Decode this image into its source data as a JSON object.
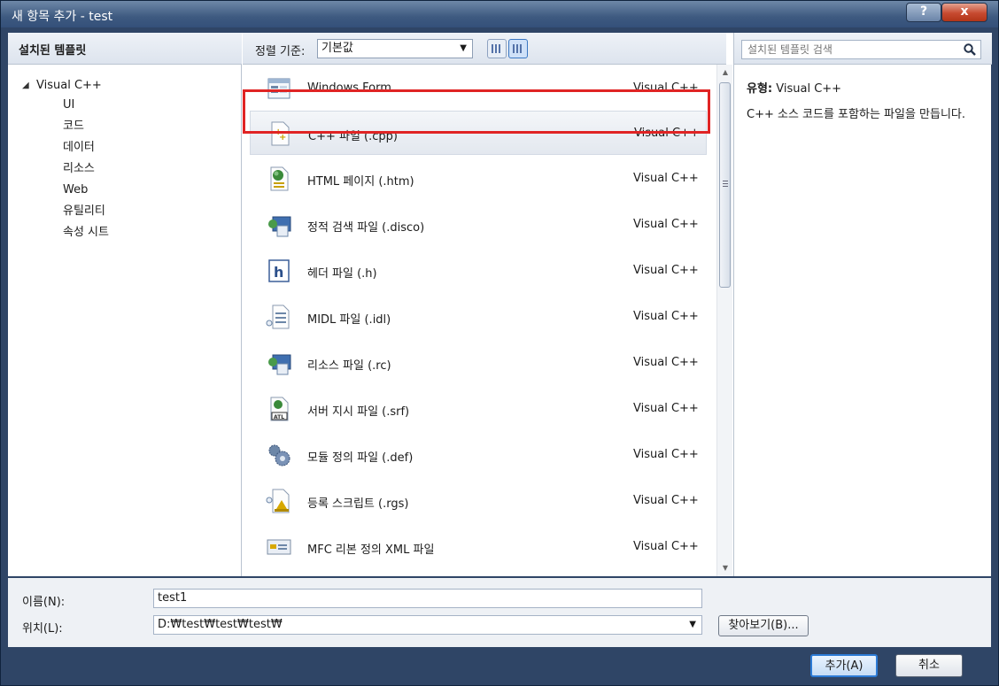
{
  "window": {
    "title": "새 항목 추가 - test",
    "help_label": "?",
    "close_label": "x"
  },
  "left": {
    "header": "설치된 템플릿",
    "tree": {
      "root": "Visual C++",
      "children": [
        "UI",
        "코드",
        "데이터",
        "리소스",
        "Web",
        "유틸리티",
        "속성 시트"
      ]
    }
  },
  "middle": {
    "sort_label": "정렬 기준:",
    "sort_value": "기본값",
    "items": [
      {
        "name": "Windows Form",
        "lang": "Visual C++",
        "icon": "windows-form-icon"
      },
      {
        "name": "C++ 파일 (.cpp)",
        "lang": "Visual C++",
        "icon": "cpp-file-icon"
      },
      {
        "name": "HTML 페이지 (.htm)",
        "lang": "Visual C++",
        "icon": "html-page-icon"
      },
      {
        "name": "정적 검색 파일 (.disco)",
        "lang": "Visual C++",
        "icon": "disco-file-icon"
      },
      {
        "name": "헤더 파일 (.h)",
        "lang": "Visual C++",
        "icon": "header-file-icon"
      },
      {
        "name": "MIDL 파일 (.idl)",
        "lang": "Visual C++",
        "icon": "midl-file-icon"
      },
      {
        "name": "리소스 파일 (.rc)",
        "lang": "Visual C++",
        "icon": "resource-file-icon"
      },
      {
        "name": "서버 지시 파일 (.srf)",
        "lang": "Visual C++",
        "icon": "srf-file-icon"
      },
      {
        "name": "모듈 정의 파일 (.def)",
        "lang": "Visual C++",
        "icon": "def-file-icon"
      },
      {
        "name": "등록 스크립트 (.rgs)",
        "lang": "Visual C++",
        "icon": "rgs-file-icon"
      },
      {
        "name": "MFC 리본 정의 XML 파일",
        "lang": "Visual C++",
        "icon": "ribbon-xml-icon"
      }
    ],
    "selected_index": 1
  },
  "right": {
    "search_placeholder": "설치된 템플릿 검색",
    "type_label": "유형:",
    "type_value": "Visual C++",
    "description": "C++ 소스 코드를 포함하는 파일을 만듭니다."
  },
  "bottom": {
    "name_label": "이름(N):",
    "name_value": "test1",
    "location_label": "위치(L):",
    "location_value": "D:₩test₩test₩test₩",
    "browse_label": "찾아보기(B)...",
    "add_label": "추가(A)",
    "cancel_label": "취소"
  },
  "colors": {
    "selection_outline": "#e02424",
    "accent": "#2c7bd6"
  }
}
